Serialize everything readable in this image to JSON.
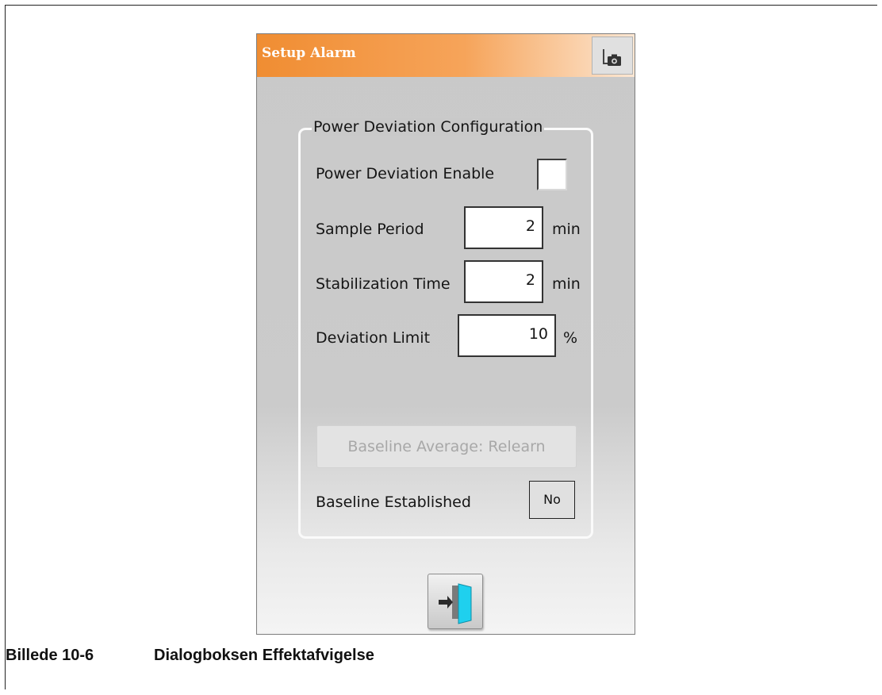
{
  "dialog": {
    "title": "Setup Alarm",
    "icons": {
      "screenshot": "screenshot-icon",
      "exit": "exit-door-icon"
    }
  },
  "config_group": {
    "legend": "Power Deviation Configuration",
    "enable_label": "Power Deviation Enable",
    "enable_checked": false,
    "sample_period": {
      "label": "Sample Period",
      "value": "2",
      "unit": "min"
    },
    "stabilization_time": {
      "label": "Stabilization Time",
      "value": "2",
      "unit": "min"
    },
    "deviation_limit": {
      "label": "Deviation Limit",
      "value": "10",
      "unit": "%"
    },
    "relearn_button": "Baseline Average: Relearn",
    "baseline_label": "Baseline Established",
    "baseline_value": "No"
  },
  "caption": {
    "number": "Billede 10-6",
    "text": "Dialogboksen Effektafvigelse"
  },
  "colors": {
    "title_accent": "#f08d32",
    "panel": "#c9c9c9",
    "exit_door": "#1fd0ee"
  }
}
